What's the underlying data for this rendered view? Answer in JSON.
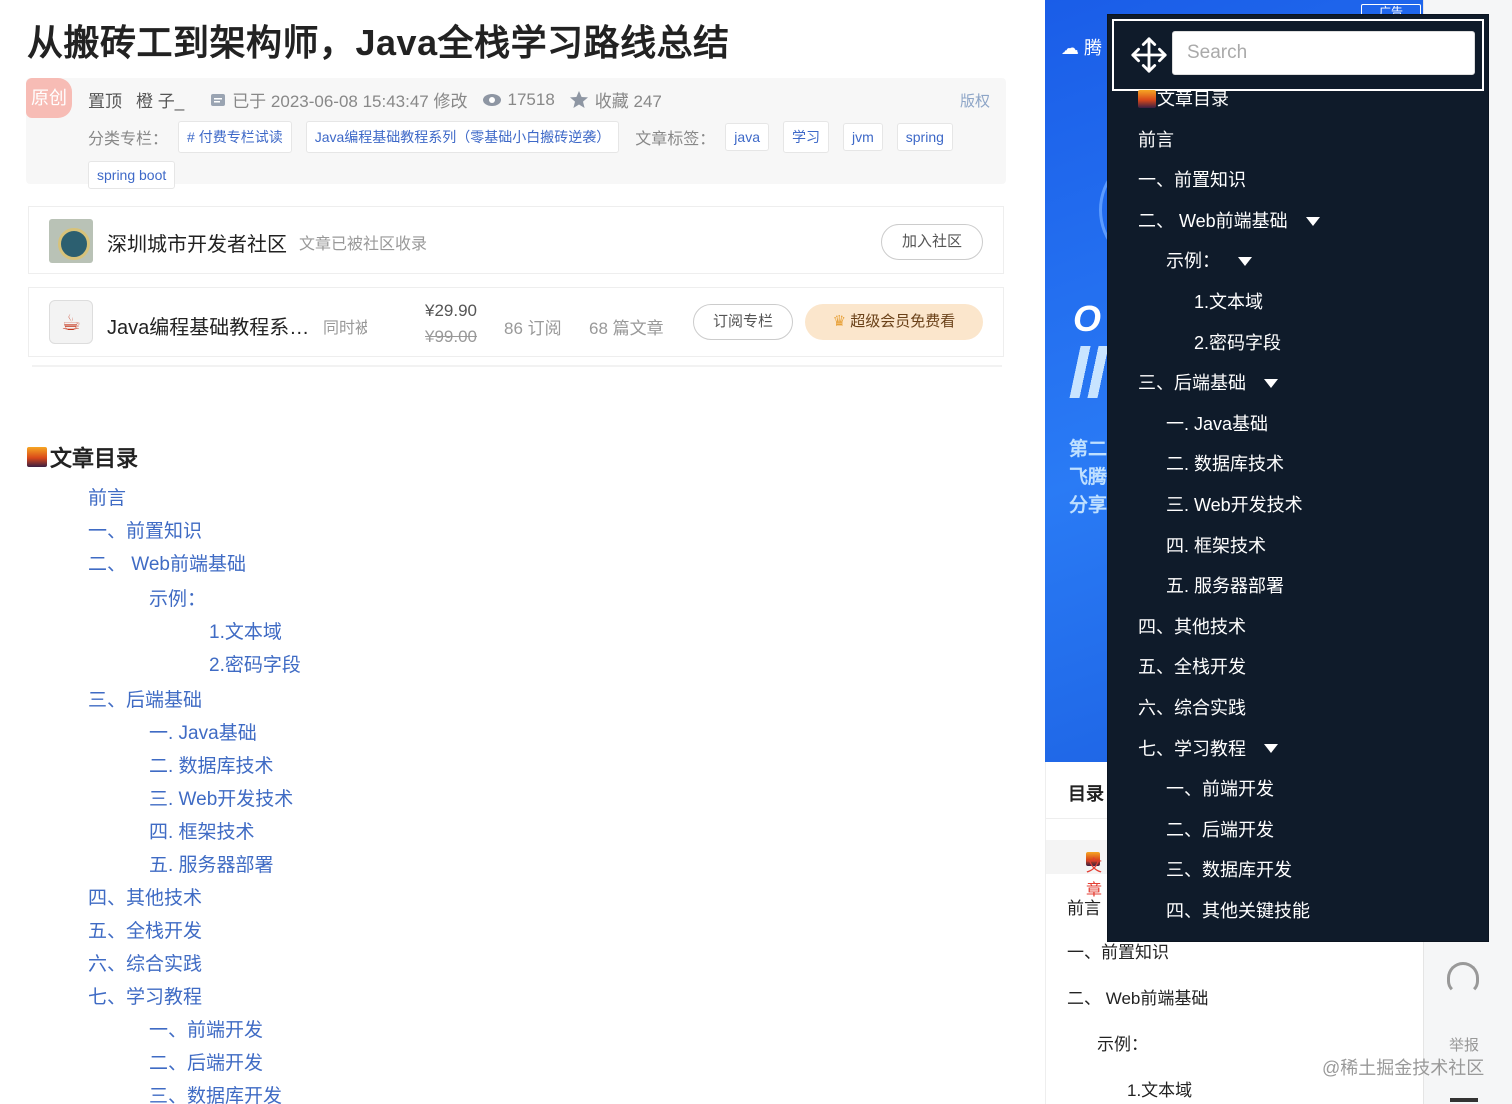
{
  "article": {
    "title": "从搬砖工到架构师，Java全栈学习路线总结",
    "badge": "原创",
    "pinned": "置顶",
    "author": "橙 子_",
    "modified": "已于 2023-06-08 15:43:47 修改",
    "views": "17518",
    "favorites": "收藏 247",
    "copyright": "版权",
    "category_label": "分类专栏：",
    "categories": [
      "# 付费专栏试读",
      "Java编程基础教程系列（零基础小白搬砖逆袭）"
    ],
    "tag_label": "文章标签：",
    "tags": [
      "java",
      "学习",
      "jvm",
      "spring",
      "spring boot"
    ]
  },
  "community": {
    "name": "深圳城市开发者社区",
    "note": "文章已被社区收录",
    "join_label": "加入社区"
  },
  "column": {
    "name": "Java编程基础教程系…",
    "same": "同时被",
    "price": "¥29.90",
    "old_price": "¥99.00",
    "subscribers": "86 订阅",
    "articles": "68 篇文章",
    "subscribe_label": "订阅专栏",
    "vip_label": "超级会员免费看"
  },
  "toc": {
    "heading": "文章目录",
    "items": [
      {
        "label": "前言",
        "level": 1
      },
      {
        "label": "一、前置知识",
        "level": 1
      },
      {
        "label": "二、 Web前端基础",
        "level": 1
      },
      {
        "label": "示例：",
        "level": 2
      },
      {
        "label": "1.文本域",
        "level": 3
      },
      {
        "label": "2.密码字段",
        "level": 3
      },
      {
        "label": "三、后端基础",
        "level": 1
      },
      {
        "label": "一. Java基础",
        "level": 2
      },
      {
        "label": "二. 数据库技术",
        "level": 2
      },
      {
        "label": "三. Web开发技术",
        "level": 2
      },
      {
        "label": "四. 框架技术",
        "level": 2
      },
      {
        "label": "五. 服务器部署",
        "level": 2
      },
      {
        "label": "四、其他技术",
        "level": 1
      },
      {
        "label": "五、全栈开发",
        "level": 1
      },
      {
        "label": "六、综合实践",
        "level": 1
      },
      {
        "label": "七、学习教程",
        "level": 1
      },
      {
        "label": "一、前端开发",
        "level": 2
      },
      {
        "label": "二、后端开发",
        "level": 2
      },
      {
        "label": "三、数据库开发",
        "level": 2
      }
    ]
  },
  "ad": {
    "tag": "广告",
    "logo": "腾",
    "big_text": "O",
    "line1": "第二",
    "line2": "飞腾",
    "line3": "分享"
  },
  "sidebar": {
    "heading": "目录",
    "active": "文章",
    "items": [
      "前言",
      "一、前置知识",
      "二、 Web前端基础",
      "示例：",
      "1.文本域"
    ]
  },
  "gutter": {
    "report": "举报",
    "watermark": "@稀土掘金技术社区"
  },
  "popup": {
    "search_placeholder": "Search",
    "items": [
      {
        "label": "文章目录",
        "level": 1,
        "emoji": true
      },
      {
        "label": "前言",
        "level": 1
      },
      {
        "label": "一、前置知识",
        "level": 1
      },
      {
        "label": "二、 Web前端基础",
        "level": 1,
        "caret": true
      },
      {
        "label": "示例：",
        "level": 2,
        "caret": true
      },
      {
        "label": "1.文本域",
        "level": 3
      },
      {
        "label": "2.密码字段",
        "level": 3
      },
      {
        "label": "三、后端基础",
        "level": 1,
        "caret": true
      },
      {
        "label": "一. Java基础",
        "level": 2
      },
      {
        "label": "二. 数据库技术",
        "level": 2
      },
      {
        "label": "三. Web开发技术",
        "level": 2
      },
      {
        "label": "四. 框架技术",
        "level": 2
      },
      {
        "label": "五. 服务器部署",
        "level": 2
      },
      {
        "label": "四、其他技术",
        "level": 1
      },
      {
        "label": "五、全栈开发",
        "level": 1
      },
      {
        "label": "六、综合实践",
        "level": 1
      },
      {
        "label": "七、学习教程",
        "level": 1,
        "caret": true
      },
      {
        "label": "一、前端开发",
        "level": 2
      },
      {
        "label": "二、后端开发",
        "level": 2
      },
      {
        "label": "三、数据库开发",
        "level": 2
      },
      {
        "label": "四、其他关键技能",
        "level": 2
      }
    ]
  },
  "colors": {
    "link": "#3f6bc4",
    "popup_bg": "#0f1b2a",
    "ad_blue": "#1a5de8",
    "badge_red": "#f7bcb5",
    "active_red": "#e33e33"
  }
}
